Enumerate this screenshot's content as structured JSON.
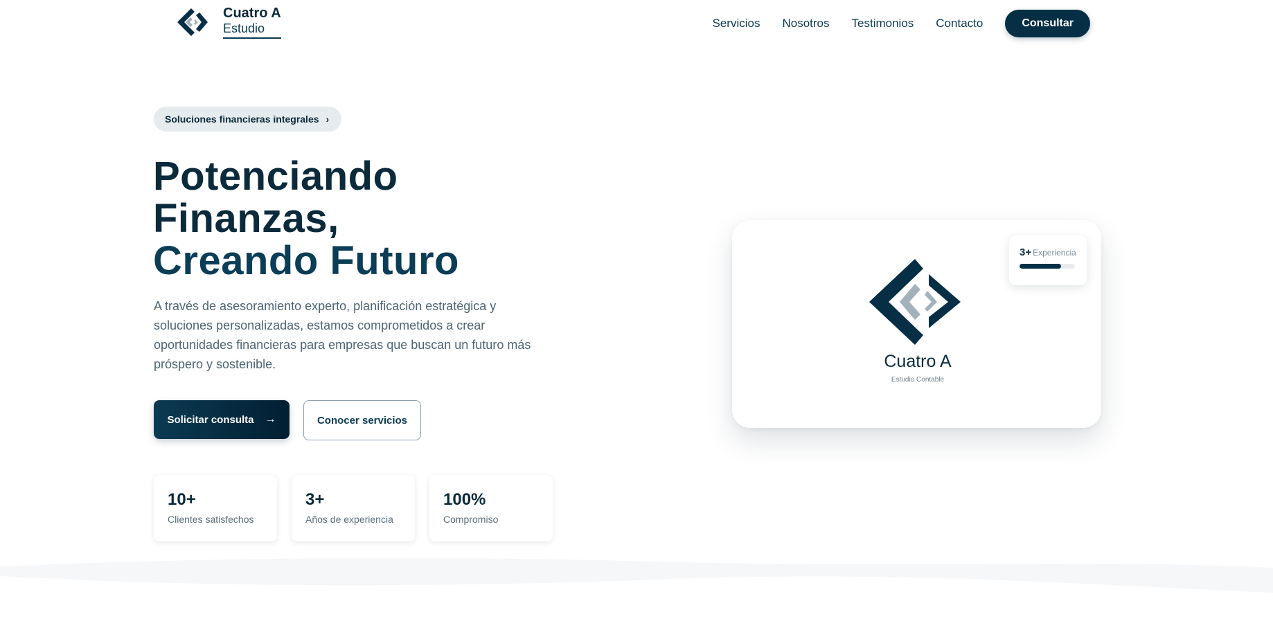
{
  "brand": {
    "title": "Cuatro A",
    "subtitle": "Estudio",
    "logo_icon": "cuatro-a-logo-icon"
  },
  "nav": {
    "links": [
      "Servicios",
      "Nosotros",
      "Testimonios",
      "Contacto"
    ],
    "cta": "Consultar"
  },
  "hero": {
    "pill": "Soluciones financieras integrales",
    "pill_icon": "chevron-right-icon",
    "headline_line1": "Potenciando",
    "headline_line2": "Finanzas,",
    "headline_line3": "Creando Futuro",
    "description": "A través de asesoramiento experto, planificación estratégica y soluciones personalizadas, estamos comprometidos a crear oportunidades financieras para empresas que buscan un futuro más próspero y sostenible.",
    "primary_button": "Solicitar consulta",
    "primary_button_icon": "arrow-right-icon",
    "secondary_button": "Conocer servicios"
  },
  "stats": [
    {
      "value": "10+",
      "label": "Clientes satisfechos"
    },
    {
      "value": "3+",
      "label": "Años de experiencia"
    },
    {
      "value": "100%",
      "label": "Compromiso"
    }
  ],
  "card": {
    "badge_value": "3+",
    "badge_label": "Experiencia",
    "badge_progress": 0.75,
    "title": "Cuatro A",
    "subtitle": "Estudio Contable"
  },
  "colors": {
    "primary": "#062f45",
    "text": "#0b2a3c",
    "muted": "#4d6473",
    "accent_gray": "#a3b1bc"
  }
}
